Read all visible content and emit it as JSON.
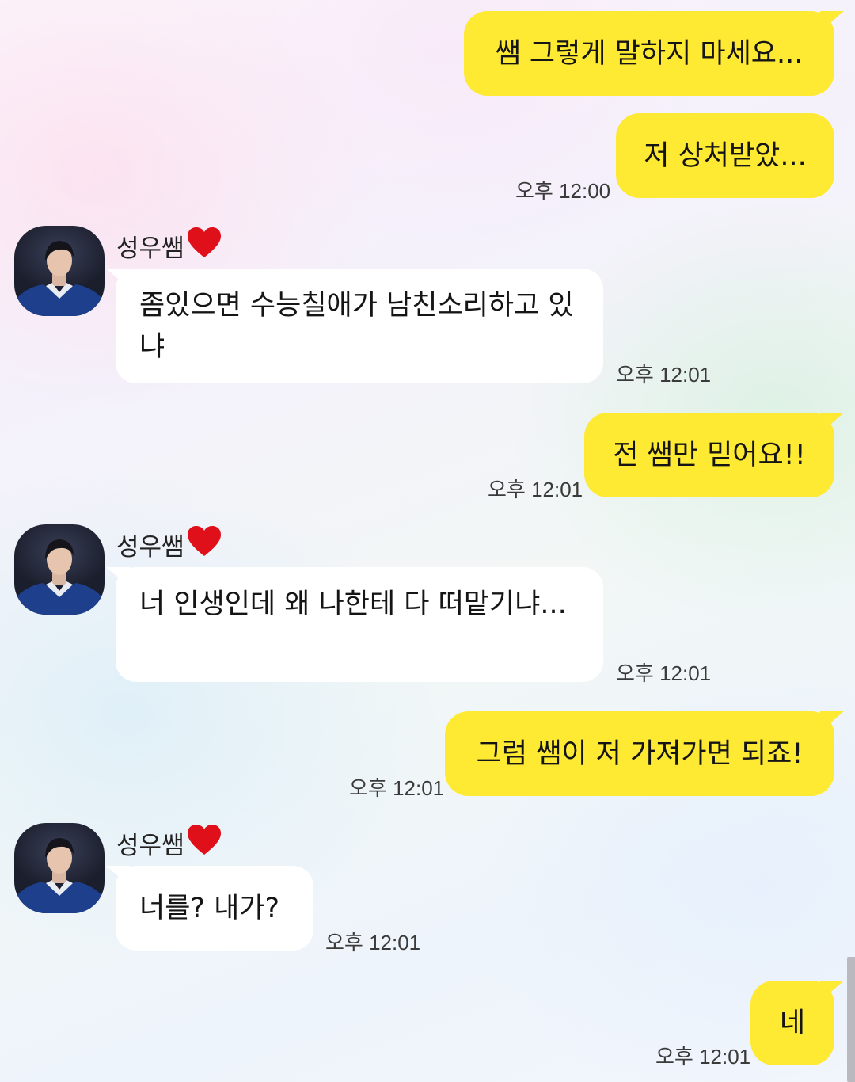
{
  "contact": {
    "name": "성우쌤",
    "heart_icon": "red-heart-icon"
  },
  "messages": [
    {
      "direction": "out",
      "text": "쌤 그렇게 말하지 마세요..."
    },
    {
      "direction": "out",
      "text": "저 상처받았...",
      "time": "오후 12:00"
    },
    {
      "direction": "in",
      "text": "좀있으면 수능칠애가 남친소리하고 있냐",
      "time": "오후 12:01"
    },
    {
      "direction": "out",
      "text": "전 쌤만 믿어요!!",
      "time": "오후 12:01"
    },
    {
      "direction": "in",
      "text": "너 인생인데 왜 나한테 다 떠맡기냐...",
      "time": "오후 12:01"
    },
    {
      "direction": "out",
      "text": "그럼 쌤이 저 가져가면 되죠!",
      "time": "오후 12:01"
    },
    {
      "direction": "in",
      "text": "너를? 내가?",
      "time": "오후 12:01"
    },
    {
      "direction": "out",
      "text": "네",
      "time": "오후 12:01"
    }
  ],
  "colors": {
    "outgoing_bubble": "#fee933",
    "incoming_bubble": "#ffffff",
    "heart": "#e0101a"
  }
}
